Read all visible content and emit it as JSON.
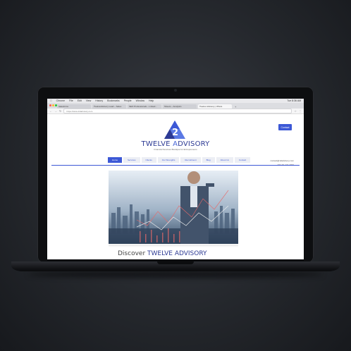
{
  "browser": {
    "menubar": {
      "items": [
        "Chrome",
        "File",
        "Edit",
        "View",
        "History",
        "Bookmarks",
        "People",
        "Window",
        "Help"
      ],
      "clock": "Tue 8:36 AM"
    },
    "tabs": [
      {
        "label": "Salesforce"
      },
      {
        "label": "TwelveAdvisory Lead – Sales"
      },
      {
        "label": "SEO Professionals – Linked…"
      },
      {
        "label": "Sheets – Analytics"
      },
      {
        "label": "Twelve Advisory | Whois"
      }
    ],
    "address": "https://www.12advisory.com"
  },
  "site": {
    "contact_button": "Contact",
    "brand_prefix": "TWELVE ",
    "brand_a": "A",
    "brand_suffix": "DVISORY",
    "tagline": "Financial Services Boutique for Entrepreneurs",
    "nav": [
      "Home",
      "Services",
      "Clients",
      "Our Strengths",
      "Recruitment",
      "Blog",
      "About Us",
      "Contact"
    ],
    "email": "contact@12advisory.com",
    "phone": "+972-54-432-7090",
    "discover_prefix": "Discover ",
    "discover_brand": "TWELVE ADVISORY"
  },
  "colors": {
    "accent": "#3c58d6",
    "brand_dark": "#2d3a94"
  }
}
